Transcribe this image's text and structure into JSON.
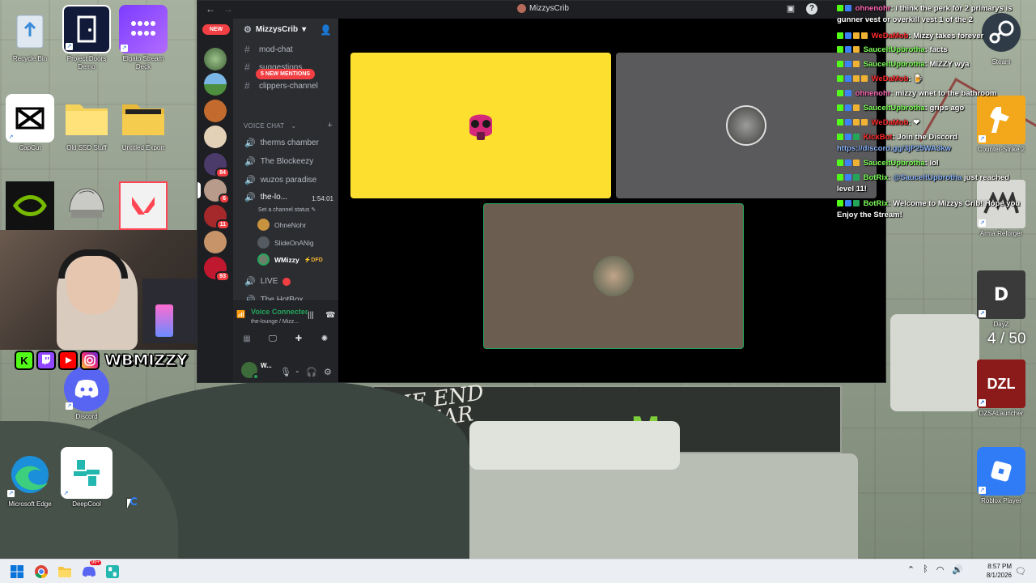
{
  "desktop": {
    "icons_left": [
      {
        "label": "Recycle Bin"
      },
      {
        "label": "Project Doors Demo"
      },
      {
        "label": "Elgato Stream Deck"
      },
      {
        "label": "CapCut"
      },
      {
        "label": "Old SSD Stuff"
      },
      {
        "label": "Untitled Export"
      },
      {
        "label": "Discord"
      },
      {
        "label": "Microsoft Edge"
      },
      {
        "label": "DeepCool"
      }
    ],
    "icons_right": [
      {
        "label": "Steam"
      },
      {
        "label": "Counter-Strike 2"
      },
      {
        "label": "Arma Reforger"
      },
      {
        "label": "DayZ"
      },
      {
        "label": "DZSALauncher"
      },
      {
        "label": "Roblox Player"
      }
    ],
    "wallpaper_text": "THE END\n'S NEAR",
    "overlay_stat": "4 / 50"
  },
  "stream_overlay": {
    "socials": [
      "K",
      "twitch",
      "youtube",
      "instagram"
    ],
    "handle": "WBMIZZY"
  },
  "discord": {
    "window_title": "MizzysCrib",
    "new_label": "NEW",
    "server_name": "MizzysCrib",
    "mentions_banner": "5 NEW MENTIONS",
    "text_channels": [
      {
        "name": "mod-chat"
      },
      {
        "name": "suggestions"
      },
      {
        "name": "clippers-channel"
      }
    ],
    "voice_category": "VOICE CHAT",
    "voice_channels": [
      {
        "name": "therms chamber"
      },
      {
        "name": "The Blockeezy"
      },
      {
        "name": "wuzos paradise"
      },
      {
        "name": "the-lo...",
        "timer": "1:54:01",
        "status": "Set a channel status"
      },
      {
        "name": "LIVE"
      },
      {
        "name": "The HotBox"
      }
    ],
    "voice_members": [
      {
        "name": "OhneNohr"
      },
      {
        "name": "SlideOnANig"
      },
      {
        "name": "WMizzy",
        "tag": "DFD"
      }
    ],
    "server_badges": [
      "84",
      "6",
      "11",
      "93"
    ],
    "voice_panel": {
      "title": "Voice Connected",
      "subtitle": "the-lounge / Mizz..."
    },
    "user_panel": {
      "name": "W..."
    }
  },
  "chat": {
    "messages": [
      {
        "user": "ohnenohr",
        "color": "#ff69b4",
        "text": "i think the perk for 2 primarys is gunner vest or overkill vest 1 of the 2"
      },
      {
        "user": "WeDaMob",
        "color": "#ff2a2a",
        "text": "Mizzy takes forever"
      },
      {
        "user": "SauceItUpbrotha",
        "color": "#7fff5a",
        "text": "facts"
      },
      {
        "user": "SauceItUpbrotha",
        "color": "#7fff5a",
        "text": "MIZZY wya"
      },
      {
        "user": "WeDaMob",
        "color": "#ff2a2a",
        "text": "🍺"
      },
      {
        "user": "ohnenohr",
        "color": "#ff69b4",
        "text": "mizzy wnet to the bathroom"
      },
      {
        "user": "SauceItUpbrotha",
        "color": "#7fff5a",
        "text": "grips ago"
      },
      {
        "user": "WeDaMob",
        "color": "#ff2a2a",
        "text": "❤"
      },
      {
        "user": "KickBot",
        "color": "#ff2a2a",
        "text": "Join the Discord",
        "link": "https://discord.gg/3jP25WA3kw"
      },
      {
        "user": "SauceItUpbrotha",
        "color": "#7fff5a",
        "text": "lol"
      },
      {
        "user": "BotRix",
        "color": "#7fff5a",
        "mention": "@SauceItUpbrotha",
        "text": "just reached level 11!"
      },
      {
        "user": "BotRix",
        "color": "#7fff5a",
        "text": "Welcome to Mizzys Crib! Hope you Enjoy the Stream!"
      }
    ]
  },
  "taskbar": {
    "apps": [
      "start",
      "chrome",
      "file-explorer",
      "discord",
      "deepcool"
    ],
    "discord_badge": "99+",
    "time": "8:57 PM",
    "date": "8/1/2026"
  },
  "colors": {
    "discord_bg": "#2b2d31",
    "discord_dark": "#1e1f22",
    "voice_green": "#23a55a",
    "tile_yellow": "#fde02f",
    "tile_grey": "#5a5a5c",
    "tile_brown": "#6b5d4f"
  }
}
